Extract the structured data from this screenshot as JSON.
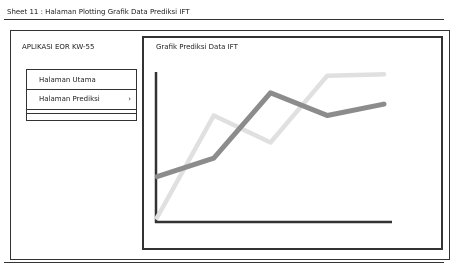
{
  "sheet": {
    "title": "Sheet 11 : Halaman Plotting Grafik Data Prediksi IFT"
  },
  "app": {
    "title": "APLIKASI EOR KW-55"
  },
  "menu": {
    "items": [
      {
        "label": "Halaman Utama",
        "chevron": ""
      },
      {
        "label": "Halaman Prediksi",
        "chevron": "›"
      }
    ]
  },
  "chart": {
    "title": "Grafik Prediksi Data IFT"
  },
  "chart_data": {
    "type": "line",
    "title": "Grafik Prediksi Data IFT",
    "xlabel": "",
    "ylabel": "",
    "x": [
      0,
      1,
      2,
      3,
      4
    ],
    "xlim": [
      0,
      4
    ],
    "ylim": [
      0,
      10
    ],
    "grid": false,
    "series": [
      {
        "values": [
          3.2,
          4.5,
          9.1,
          7.5,
          8.3
        ],
        "color": "#8c8c8c"
      },
      {
        "values": [
          0.3,
          7.5,
          5.6,
          10.3,
          10.4
        ],
        "color": "#e0e0e0"
      }
    ]
  }
}
